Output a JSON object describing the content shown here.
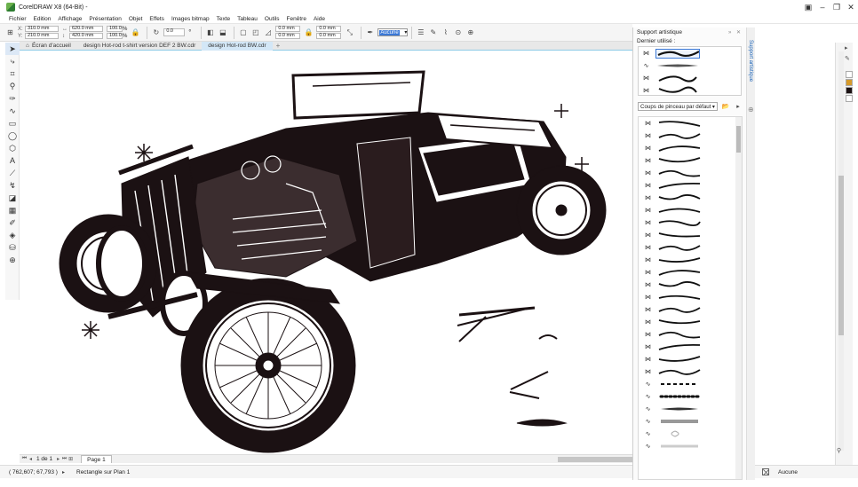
{
  "app": {
    "title": "CorelDRAW X8 (64-Bit) -"
  },
  "menu": [
    "Fichier",
    "Edition",
    "Affichage",
    "Présentation",
    "Objet",
    "Effets",
    "Images bitmap",
    "Texte",
    "Tableau",
    "Outils",
    "Fenêtre",
    "Aide"
  ],
  "propbar": {
    "x": "310.0 mm",
    "y": "210.0 mm",
    "width": "620.0 mm",
    "height": "420.0 mm",
    "scale_w": "100.0",
    "scale_h": "100.0",
    "percent": "%",
    "rotation": "0.0",
    "corner1": "0.0 mm",
    "corner2": "0.0 mm",
    "corner3": "0.0 mm",
    "corner4": "0.0 mm",
    "outline": "Aucune"
  },
  "tabs": [
    "Écran d'accueil",
    "design Hot-rod t-shirt version DEF 2 BW.cdr",
    "design Hot-rod BW.cdr"
  ],
  "pager": {
    "current": "1 de 1",
    "page_tab": "Page 1"
  },
  "status": {
    "coords": "( 762,607; 67,793 )",
    "arrow": "▸",
    "info": "Rectangle sur Plan 1",
    "fill": "Aucune"
  },
  "docker": {
    "title": "Support artistique",
    "recent_label": "Dernier utilisé :",
    "category": "Coups de pinceau par défaut",
    "side_tab": "Support artistique"
  },
  "icons": {
    "docker_brush": "brush-icon",
    "stroke_type": "stroke-type-icon"
  },
  "colors": {
    "accent": "#3a78d6",
    "artwork": "#1b1113",
    "selection_tab": "#d3e7f7"
  }
}
